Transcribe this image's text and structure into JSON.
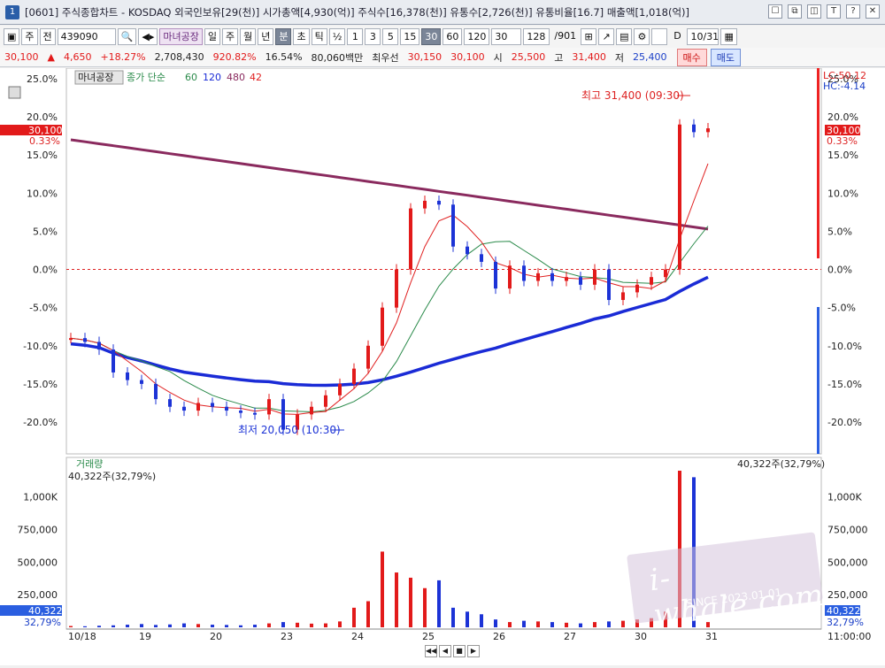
{
  "window": {
    "number": "1",
    "title": "[0601] 주식종합차트 - KOSDAQ 외국인보유[29(천)] 시가총액[4,930(억)] 주식수[16,378(천)] 유통수[2,726(천)] 유통비율[16.7] 매출액[1,018(억)]",
    "buttons": [
      "☐",
      "⧉",
      "◫",
      "T",
      "?",
      "✕"
    ]
  },
  "toolbar": {
    "period_select": "주",
    "prev_label": "전",
    "code_value": "439090",
    "stock_name": "마녀공장",
    "period_tabs": [
      "일",
      "주",
      "월",
      "년",
      "분",
      "초",
      "틱"
    ],
    "active_tab": "분",
    "half_label": "½",
    "minute_buttons": [
      "1",
      "3",
      "5",
      "15",
      "30",
      "60",
      "120"
    ],
    "active_minute": "30",
    "minute_value": "30",
    "count_value": "128",
    "count_total": "/901",
    "d_label": "D",
    "date_value": "10/31"
  },
  "pricebar": {
    "price": "30,100",
    "change": "4,650",
    "change_pct": "+18.27%",
    "volume": "2,708,430",
    "volume_ratio": "920.82%",
    "turnover": "16.54%",
    "amount": "80,060백만",
    "best_ask_label": "최우선",
    "best_ask": "30,150",
    "best_bid": "30,100",
    "open_label": "시",
    "open": "25,500",
    "high_label": "고",
    "high": "31,400",
    "low_label": "저",
    "low": "25,400",
    "buy_label": "매수",
    "sell_label": "매도"
  },
  "chart": {
    "legend_name": "마녀공장",
    "legend_ma": "종가 단순",
    "ma_periods": [
      "60",
      "120",
      "480",
      "42"
    ],
    "lc_label": "LC:50.12",
    "hc_label": "HC:-4.14",
    "y_ticks": [
      "25.0%",
      "20.0%",
      "15.0%",
      "10.0%",
      "5.0%",
      "0.0%",
      "-5.0%",
      "-10.0%",
      "-15.0%",
      "-20.0%"
    ],
    "current_price_tag": "30,100",
    "current_pct": "0.33%",
    "high_annotation": "최고 31,400 (09:30)",
    "low_annotation": "최저 20,050 (10:30)",
    "volume_title": "거래량",
    "volume_value": "40,322주(32,79%)",
    "volume_value_right": "40,322주(32,79%)",
    "vol_ticks": [
      "1,000K",
      "750,000",
      "500,000",
      "250,000"
    ],
    "vol_tag": "40,322",
    "vol_tag_pct": "32,79%",
    "x_labels": [
      "10/18",
      "19",
      "20",
      "23",
      "24",
      "25",
      "26",
      "27",
      "30",
      "31"
    ],
    "time_label": "11:00:00",
    "colors": {
      "up": "#e21a1a",
      "down": "#1c33d6",
      "ma60": "#e02020",
      "ma120": "#2a8a4a",
      "ma480": "#1a2bd6",
      "ma42": "#8a2a5e"
    }
  },
  "chart_data": {
    "type": "candlestick",
    "series": [
      {
        "name": "마녀공장",
        "values_pct": [
          -9.0,
          -9.5,
          -10.5,
          -13.5,
          -14.5,
          -15.0,
          -17.0,
          -18.0,
          -18.5,
          -17.5,
          -18.0,
          -18.5,
          -18.8,
          -19.0,
          -17.0,
          -21.0,
          -19.0,
          -18.0,
          -16.5,
          -15.0,
          -13.0,
          -10.0,
          -5.0,
          0.0,
          8.0,
          9.0,
          8.5,
          3.0,
          2.0,
          1.0,
          -2.5,
          0.5,
          -1.5,
          -0.5,
          -1.5,
          -1.0,
          -2.0,
          0.0,
          -4.0,
          -3.0,
          -2.0,
          -1.0,
          0.0,
          19.0,
          18.0,
          18.5
        ]
      }
    ],
    "ylim": [
      -20,
      25
    ],
    "vol_values_k": [
      10,
      8,
      12,
      15,
      20,
      25,
      18,
      22,
      30,
      25,
      20,
      18,
      15,
      20,
      30,
      40,
      35,
      28,
      30,
      45,
      150,
      200,
      580,
      420,
      380,
      300,
      360,
      150,
      120,
      100,
      60,
      40,
      50,
      45,
      40,
      35,
      30,
      40,
      45,
      50,
      60,
      70,
      120,
      1200,
      1150,
      40
    ]
  }
}
